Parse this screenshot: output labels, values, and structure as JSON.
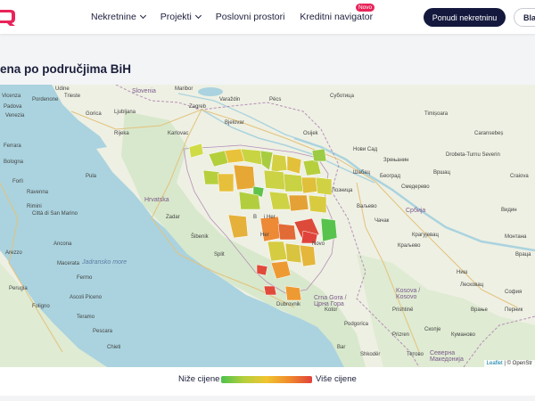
{
  "header": {
    "nav": [
      {
        "label": "Nekretnine",
        "has_dropdown": true
      },
      {
        "label": "Projekti",
        "has_dropdown": true
      },
      {
        "label": "Poslovni prostori",
        "has_dropdown": false
      },
      {
        "label": "Kreditni navigator",
        "has_dropdown": false,
        "badge": "Novo"
      }
    ],
    "primary_button": "Ponudi nekretninu",
    "secondary_button": "Bla",
    "logo_color": "#e8245a"
  },
  "section": {
    "title": "ena po područjima BiH"
  },
  "map": {
    "countries": [
      {
        "id": "slovenia",
        "text": "Slovenia"
      },
      {
        "id": "hrvatska",
        "text": "Hrvatska"
      },
      {
        "id": "srbija",
        "text": "Србија"
      },
      {
        "id": "crna-gora",
        "text": "Crna Gora /\nЦрна Гора"
      },
      {
        "id": "kosova",
        "text": "Kosova /\nKosovo"
      },
      {
        "id": "makedonija",
        "text": "Северна\nМакедонија"
      }
    ],
    "seas": [
      {
        "id": "jadransko",
        "text": "Jadransko more"
      }
    ],
    "cities": [
      {
        "id": "zagreb",
        "text": "Zagreb"
      },
      {
        "id": "ljubljana",
        "text": "Ljubljana"
      },
      {
        "id": "rijeka",
        "text": "Rijeka"
      },
      {
        "id": "karlovac",
        "text": "Karlovac"
      },
      {
        "id": "zadar",
        "text": "Zadar"
      },
      {
        "id": "split",
        "text": "Split"
      },
      {
        "id": "dubrovnik",
        "text": "Dubrovnik"
      },
      {
        "id": "pula",
        "text": "Pula"
      },
      {
        "id": "trieste",
        "text": "Trieste"
      },
      {
        "id": "venezia",
        "text": "Venezia"
      },
      {
        "id": "padova",
        "text": "Padova"
      },
      {
        "id": "bologna",
        "text": "Bologna"
      },
      {
        "id": "ravenna",
        "text": "Ravenna"
      },
      {
        "id": "rimini",
        "text": "Rimini"
      },
      {
        "id": "ancona",
        "text": "Ancona"
      },
      {
        "id": "pescara",
        "text": "Pescara"
      },
      {
        "id": "perugia",
        "text": "Perugia"
      },
      {
        "id": "novi-sad",
        "text": "Нови Сад"
      },
      {
        "id": "beograd",
        "text": "Београд"
      },
      {
        "id": "kragujevac",
        "text": "Крагујевац"
      },
      {
        "id": "nis",
        "text": "Ниш"
      },
      {
        "id": "timisoara",
        "text": "Timișoara"
      },
      {
        "id": "subotica",
        "text": "Суботица"
      },
      {
        "id": "pecs",
        "text": "Pécs"
      },
      {
        "id": "osijek",
        "text": "Osijek"
      },
      {
        "id": "sofia",
        "text": "София"
      },
      {
        "id": "skopje",
        "text": "Скопје"
      },
      {
        "id": "podgorica",
        "text": "Podgorica"
      },
      {
        "id": "pristina",
        "text": "Prishtinë"
      },
      {
        "id": "craiova",
        "text": "Craiova"
      },
      {
        "id": "drobeta",
        "text": "Drobeta-Turnu Severin"
      },
      {
        "id": "caransebes",
        "text": "Caransebeș"
      },
      {
        "id": "zrenjanin",
        "text": "Зрењанин"
      },
      {
        "id": "smederevo",
        "text": "Смедерево"
      },
      {
        "id": "cacak",
        "text": "Чачак"
      },
      {
        "id": "kraljevo",
        "text": "Краљево"
      },
      {
        "id": "leskovac",
        "text": "Лесковац"
      },
      {
        "id": "vranje",
        "text": "Врање"
      },
      {
        "id": "sibenik",
        "text": "Šibenik"
      },
      {
        "id": "kotor",
        "text": "Kotor"
      },
      {
        "id": "bar",
        "text": "Bar"
      },
      {
        "id": "shkoder",
        "text": "Shkodër"
      },
      {
        "id": "prizren",
        "text": "Prizren"
      },
      {
        "id": "tetovo",
        "text": "Тетово"
      },
      {
        "id": "varazdin",
        "text": "Varaždin"
      },
      {
        "id": "bjelovar",
        "text": "Bjelovar"
      },
      {
        "id": "maribor",
        "text": "Maribor"
      },
      {
        "id": "gorica",
        "text": "Gorica"
      },
      {
        "id": "citta",
        "text": "Città di San Marino"
      },
      {
        "id": "loznica",
        "text": "Лозница"
      },
      {
        "id": "sabac",
        "text": "Шабац"
      },
      {
        "id": "valjevo",
        "text": "Ваљево"
      },
      {
        "id": "vrsac",
        "text": "Вршац"
      },
      {
        "id": "vidin",
        "text": "Видин"
      },
      {
        "id": "montana",
        "text": "Монтана"
      },
      {
        "id": "vratsa",
        "text": "Враца"
      },
      {
        "id": "pernik",
        "text": "Перник"
      },
      {
        "id": "kumanovo",
        "text": "Куманово"
      },
      {
        "id": "pordenone",
        "text": "Pordenone"
      },
      {
        "id": "udine",
        "text": "Udine"
      },
      {
        "id": "vicenza",
        "text": "Vicenza"
      },
      {
        "id": "ferrara",
        "text": "Ferrara"
      },
      {
        "id": "forli",
        "text": "Forlì"
      },
      {
        "id": "macerata",
        "text": "Macerata"
      },
      {
        "id": "fermo",
        "text": "Fermo"
      },
      {
        "id": "teramo",
        "text": "Teramo"
      },
      {
        "id": "chieti",
        "text": "Chieti"
      },
      {
        "id": "ascoli",
        "text": "Ascoli Piceno"
      },
      {
        "id": "foligno",
        "text": "Foligno"
      },
      {
        "id": "arezzo",
        "text": "Arezzo"
      },
      {
        "id": "bosnia-b",
        "text": "B"
      },
      {
        "id": "bosnia-h",
        "text": "i Her"
      },
      {
        "id": "bosnia-her",
        "text": "Her"
      },
      {
        "id": "novo",
        "text": "Novo"
      }
    ],
    "attribution": {
      "leaflet": "Leaflet",
      "rest": " | © OpenStr"
    },
    "colors": {
      "sea": "#aad3df",
      "land": "#eef0e3",
      "bih_green": "#4cc24c",
      "bih_red": "#e0433b"
    }
  },
  "legend": {
    "low": "Niže cijene",
    "high": "Više cijene"
  }
}
